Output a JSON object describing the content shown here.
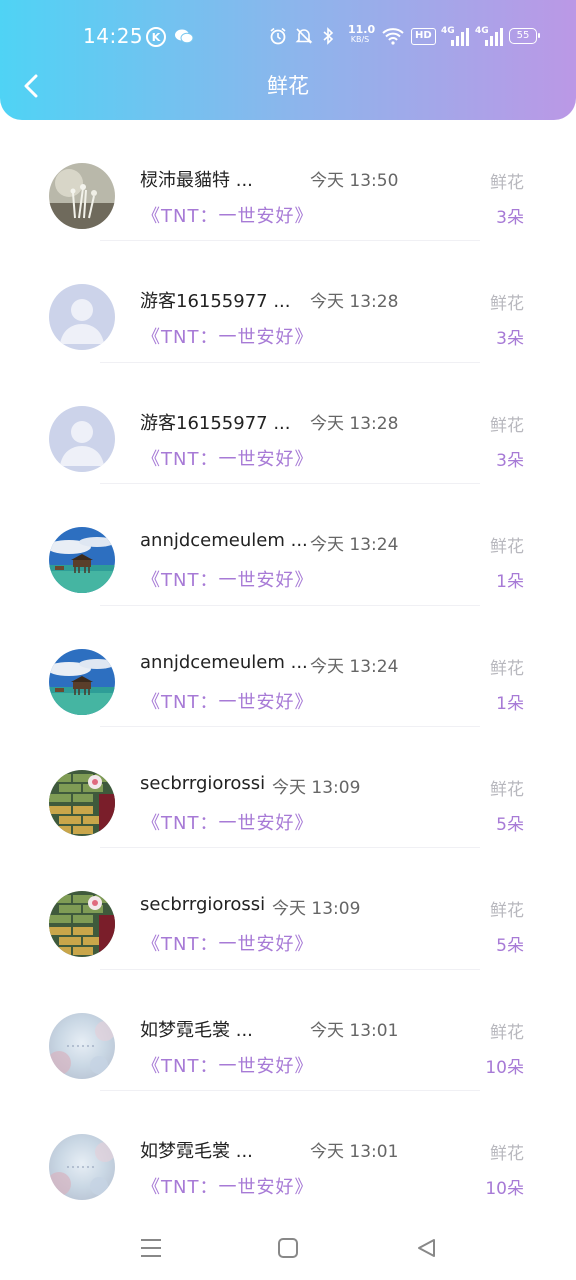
{
  "status_bar": {
    "time": "14:25",
    "net_speed_value": "11.0",
    "net_speed_unit": "KB/S",
    "hd_label": "HD",
    "sig1_label": "4G",
    "sig2_label": "4G",
    "battery": "55"
  },
  "header": {
    "title": "鲜花"
  },
  "colors": {
    "gradient_start": "#4fd3f5",
    "gradient_end": "#bb98e6",
    "accent": "#a77ad6"
  },
  "records": [
    {
      "name": "棂沛最貓特 ...",
      "time": "今天 13:50",
      "gift": "《TNT：一世安好》",
      "type": "鲜花",
      "count": "3朵",
      "avatar": "flower-photo"
    },
    {
      "name": "游客16155977 ...",
      "time": "今天 13:28",
      "gift": "《TNT：一世安好》",
      "type": "鲜花",
      "count": "3朵",
      "avatar": "default-user"
    },
    {
      "name": "游客16155977 ...",
      "time": "今天 13:28",
      "gift": "《TNT：一世安好》",
      "type": "鲜花",
      "count": "3朵",
      "avatar": "default-user"
    },
    {
      "name": "annjdcemeulem ...",
      "time": "今天 13:24",
      "gift": "《TNT：一世安好》",
      "type": "鲜花",
      "count": "1朵",
      "avatar": "ocean-hut"
    },
    {
      "name": "annjdcemeulem ...",
      "time": "今天 13:24",
      "gift": "《TNT：一世安好》",
      "type": "鲜花",
      "count": "1朵",
      "avatar": "ocean-hut"
    },
    {
      "name": "secbrrgiorossi",
      "time": "今天 13:09",
      "gift": "《TNT：一世安好》",
      "type": "鲜花",
      "count": "5朵",
      "avatar": "brick-wall"
    },
    {
      "name": "secbrrgiorossi",
      "time": "今天 13:09",
      "gift": "《TNT：一世安好》",
      "type": "鲜花",
      "count": "5朵",
      "avatar": "brick-wall"
    },
    {
      "name": "如梦霓毛裳 ...",
      "time": "今天 13:01",
      "gift": "《TNT：一世安好》",
      "type": "鲜花",
      "count": "10朵",
      "avatar": "blur-photo"
    },
    {
      "name": "如梦霓毛裳 ...",
      "time": "今天 13:01",
      "gift": "《TNT：一世安好》",
      "type": "鲜花",
      "count": "10朵",
      "avatar": "blur-photo"
    }
  ]
}
